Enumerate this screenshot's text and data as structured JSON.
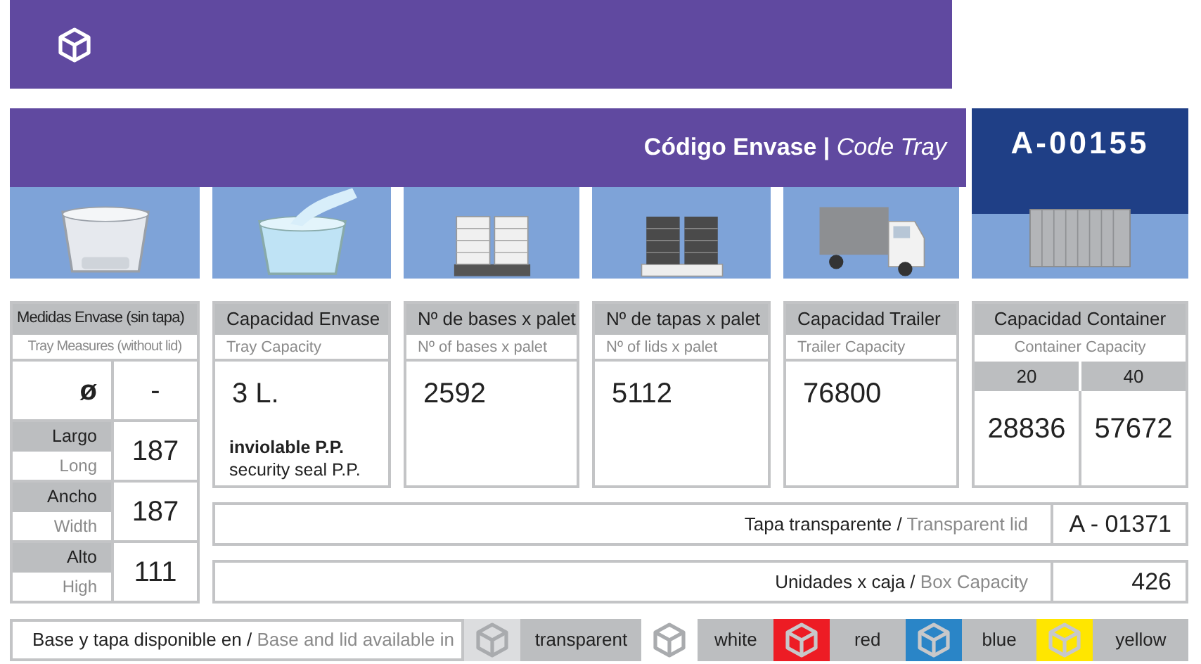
{
  "header": {
    "code_label": "Código Envase |",
    "code_label_en": "Code Tray",
    "code": "A-00155"
  },
  "illustrations": [
    {
      "kind": "tray"
    },
    {
      "kind": "filled_tray"
    },
    {
      "kind": "base_pallet"
    },
    {
      "kind": "lid_pallet"
    },
    {
      "kind": "truck"
    },
    {
      "kind": "container"
    }
  ],
  "measures": {
    "title": "Medidas Envase (sin tapa)",
    "subtitle": "Tray Measures (without lid)",
    "diameter_symbol": "ø",
    "diameter": "-",
    "dims": [
      {
        "label": "Largo",
        "label_en": "Long",
        "value": "187"
      },
      {
        "label": "Ancho",
        "label_en": "Width",
        "value": "187"
      },
      {
        "label": "Alto",
        "label_en": "High",
        "value": "111"
      }
    ]
  },
  "columns": [
    {
      "title": "Capacidad Envase",
      "subtitle": "Tray Capacity",
      "value": "3 L.",
      "note_bold": "inviolable P.P.",
      "note": "security seal P.P."
    },
    {
      "title": "Nº de bases x palet",
      "subtitle": "Nº of bases x palet",
      "value": "2592"
    },
    {
      "title": "Nº de tapas x palet",
      "subtitle": "Nº of lids x palet",
      "value": "5112"
    },
    {
      "title": "Capacidad Trailer",
      "subtitle": "Trailer Capacity",
      "value": "76800"
    }
  ],
  "container": {
    "title": "Capacidad Container",
    "subtitle": "Container Capacity",
    "sizes": [
      {
        "label": "20",
        "value": "28836"
      },
      {
        "label": "40",
        "value": "57672"
      }
    ]
  },
  "rows": [
    {
      "label": "Tapa transparente /",
      "label_en": "Transparent lid",
      "value": "A - 01371"
    },
    {
      "label": "Unidades x caja /",
      "label_en": "Box Capacity",
      "value": "426"
    }
  ],
  "availability": {
    "label": "Base y tapa disponible en /",
    "label_en": "Base and lid available in",
    "colors": [
      {
        "name": "transparent",
        "color": "#dcdddf"
      },
      {
        "name": "white",
        "color": "#ffffff"
      },
      {
        "name": "red",
        "color": "#ed1c24"
      },
      {
        "name": "blue",
        "color": "#2a85c7"
      },
      {
        "name": "yellow",
        "color": "#ffe600"
      }
    ]
  }
}
